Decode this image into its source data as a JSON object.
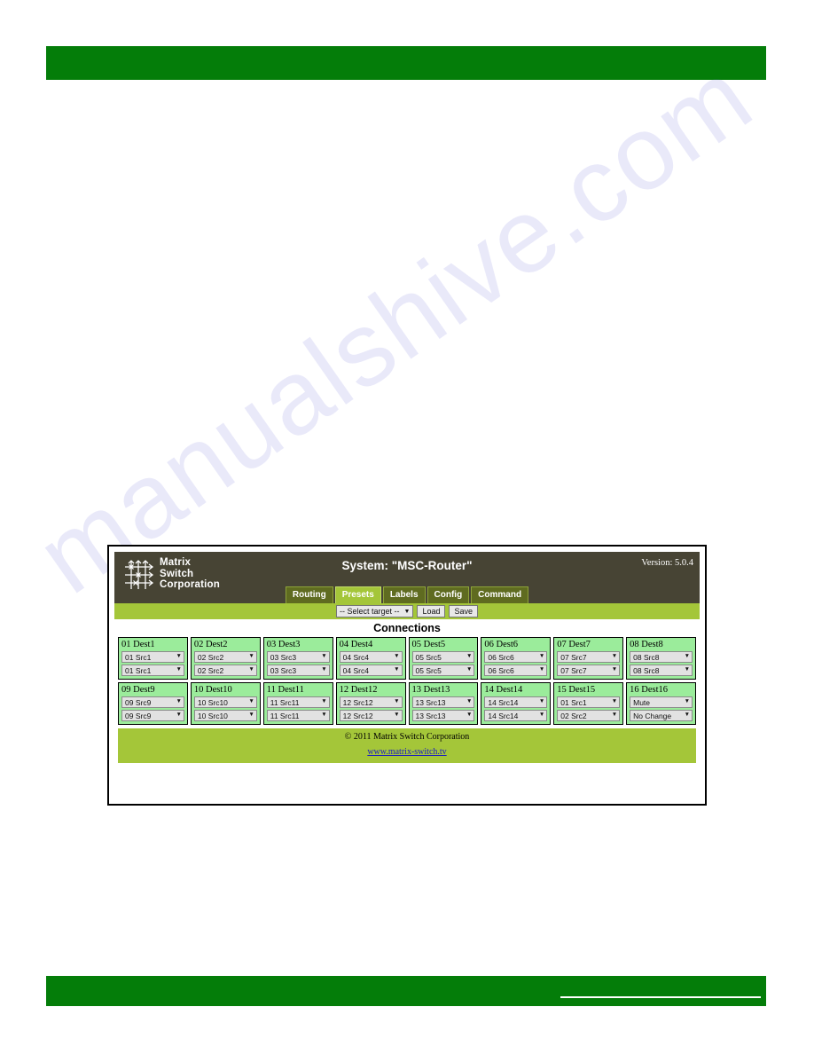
{
  "document": {
    "watermark_text": "manualshive.com"
  },
  "decor": {
    "top_bar_color": "#047d09",
    "bottom_bar_color": "#047d09"
  },
  "app": {
    "logo": {
      "icon": "matrix-crosspoint-icon",
      "line1": "Matrix",
      "line2": "Switch",
      "line3": "Corporation"
    },
    "system_title": "System: \"MSC-Router\"",
    "version": "Version: 5.0.4",
    "tabs": [
      {
        "label": "Routing",
        "active": false
      },
      {
        "label": "Presets",
        "active": true
      },
      {
        "label": "Labels",
        "active": false
      },
      {
        "label": "Config",
        "active": false
      },
      {
        "label": "Command",
        "active": false
      }
    ],
    "action_bar": {
      "target_select": "-- Select target --",
      "load_label": "Load",
      "save_label": "Save"
    },
    "connections": {
      "heading": "Connections",
      "cells": [
        {
          "title": "01 Dest1",
          "video": "01 Src1",
          "audio": "01 Src1"
        },
        {
          "title": "02 Dest2",
          "video": "02 Src2",
          "audio": "02 Src2"
        },
        {
          "title": "03 Dest3",
          "video": "03 Src3",
          "audio": "03 Src3"
        },
        {
          "title": "04 Dest4",
          "video": "04 Src4",
          "audio": "04 Src4"
        },
        {
          "title": "05 Dest5",
          "video": "05 Src5",
          "audio": "05 Src5"
        },
        {
          "title": "06 Dest6",
          "video": "06 Src6",
          "audio": "06 Src6"
        },
        {
          "title": "07 Dest7",
          "video": "07 Src7",
          "audio": "07 Src7"
        },
        {
          "title": "08 Dest8",
          "video": "08 Src8",
          "audio": "08 Src8"
        },
        {
          "title": "09 Dest9",
          "video": "09 Src9",
          "audio": "09 Src9"
        },
        {
          "title": "10 Dest10",
          "video": "10 Src10",
          "audio": "10 Src10"
        },
        {
          "title": "11 Dest11",
          "video": "11 Src11",
          "audio": "11 Src11"
        },
        {
          "title": "12 Dest12",
          "video": "12 Src12",
          "audio": "12 Src12"
        },
        {
          "title": "13 Dest13",
          "video": "13 Src13",
          "audio": "13 Src13"
        },
        {
          "title": "14 Dest14",
          "video": "14 Src14",
          "audio": "14 Src14"
        },
        {
          "title": "15 Dest15",
          "video": "01 Src1",
          "audio": "02 Src2"
        },
        {
          "title": "16 Dest16",
          "video": "Mute",
          "audio": "No Change"
        }
      ]
    },
    "footer": {
      "copyright": "© 2011 Matrix Switch Corporation",
      "link": "www.matrix-switch.tv"
    },
    "colors": {
      "header_bg": "#474434",
      "accent_green": "#a4c639",
      "tab_inactive": "#5f6b20",
      "cell_bg": "#9bec9b"
    }
  }
}
